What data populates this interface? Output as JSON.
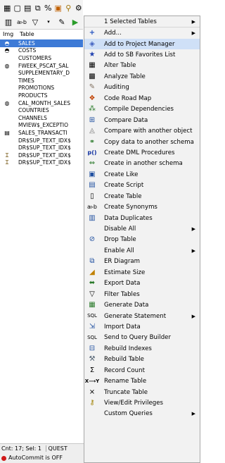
{
  "toolbar": {
    "row1_icons": [
      "table-icon",
      "new-icon",
      "open-icon",
      "copy-icon",
      "percent-icon",
      "run-icon",
      "search-icon",
      "tools-icon"
    ],
    "row2_icons": [
      "grid-icon",
      "ab-icon",
      "filter-icon",
      "dropdown-icon",
      "wrench-icon",
      "play-icon"
    ]
  },
  "grid": {
    "col_img": "Img",
    "col_table": "Table",
    "rows": [
      {
        "name": "SALES",
        "icon": "table-icon",
        "selected": true
      },
      {
        "name": "COSTS",
        "icon": "table-icon",
        "selected": false
      },
      {
        "name": "CUSTOMERS",
        "icon": "",
        "selected": false
      },
      {
        "name": "FWEEK_PSCAT_SAL",
        "icon": "partition-icon",
        "selected": false
      },
      {
        "name": "SUPPLEMENTARY_D",
        "icon": "",
        "selected": false
      },
      {
        "name": "TIMES",
        "icon": "",
        "selected": false
      },
      {
        "name": "PROMOTIONS",
        "icon": "",
        "selected": false
      },
      {
        "name": "PRODUCTS",
        "icon": "",
        "selected": false
      },
      {
        "name": "CAL_MONTH_SALES",
        "icon": "partition-icon",
        "selected": false
      },
      {
        "name": "COUNTRIES",
        "icon": "",
        "selected": false
      },
      {
        "name": "CHANNELS",
        "icon": "",
        "selected": false
      },
      {
        "name": "MVIEW$_EXCEPTIO",
        "icon": "",
        "selected": false
      },
      {
        "name": "SALES_TRANSACTI",
        "icon": "doc-icon",
        "selected": false
      },
      {
        "name": "DR$SUP_TEXT_IDX$",
        "icon": "",
        "selected": false
      },
      {
        "name": "DR$SUP_TEXT_IDX$",
        "icon": "",
        "selected": false
      },
      {
        "name": "DR$SUP_TEXT_IDX$",
        "icon": "bar-icon",
        "selected": false
      },
      {
        "name": "DR$SUP_TEXT_IDX$",
        "icon": "bar-icon",
        "selected": false
      }
    ]
  },
  "status": {
    "counts": "Cnt: 17; Sel: 1",
    "mode": "QUEST",
    "autocommit": "AutoCommit is OFF"
  },
  "menu": {
    "items": [
      {
        "label": "1 Selected Tables",
        "icon": "",
        "submenu": true,
        "highlight": false
      },
      {
        "label": "Add...",
        "icon": "plus-icon",
        "submenu": true,
        "highlight": false
      },
      {
        "label": "Add to Project Manager",
        "icon": "project-icon",
        "submenu": false,
        "highlight": true
      },
      {
        "label": "Add to SB Favorites List",
        "icon": "star-icon",
        "submenu": false,
        "highlight": false
      },
      {
        "label": "Alter Table",
        "icon": "alter-icon",
        "submenu": false,
        "highlight": false
      },
      {
        "label": "Analyze Table",
        "icon": "analyze-icon",
        "submenu": false,
        "highlight": false
      },
      {
        "label": "Auditing",
        "icon": "audit-icon",
        "submenu": false,
        "highlight": false
      },
      {
        "label": "Code Road Map",
        "icon": "roadmap-icon",
        "submenu": false,
        "highlight": false
      },
      {
        "label": "Compile Dependencies",
        "icon": "compile-icon",
        "submenu": false,
        "highlight": false
      },
      {
        "label": "Compare Data",
        "icon": "compare-data-icon",
        "submenu": false,
        "highlight": false
      },
      {
        "label": "Compare with another object",
        "icon": "compare-icon",
        "submenu": false,
        "highlight": false
      },
      {
        "label": "Copy data to another schema",
        "icon": "copy-data-icon",
        "submenu": false,
        "highlight": false
      },
      {
        "label": "Create DML Procedures",
        "icon": "dml-icon",
        "submenu": false,
        "highlight": false
      },
      {
        "label": "Create in another schema",
        "icon": "schema-icon",
        "submenu": false,
        "highlight": false
      },
      {
        "label": "Create Like",
        "icon": "create-like-icon",
        "submenu": false,
        "highlight": false
      },
      {
        "label": "Create Script",
        "icon": "script-icon",
        "submenu": false,
        "highlight": false
      },
      {
        "label": "Create Table",
        "icon": "create-table-icon",
        "submenu": false,
        "highlight": false
      },
      {
        "label": "Create Synonyms",
        "icon": "synonym-icon",
        "submenu": false,
        "highlight": false
      },
      {
        "label": "Data Duplicates",
        "icon": "duplicates-icon",
        "submenu": false,
        "highlight": false
      },
      {
        "label": "Disable All",
        "icon": "",
        "submenu": true,
        "highlight": false
      },
      {
        "label": "Drop Table",
        "icon": "drop-icon",
        "submenu": false,
        "highlight": false
      },
      {
        "label": "Enable All",
        "icon": "",
        "submenu": true,
        "highlight": false
      },
      {
        "label": "ER Diagram",
        "icon": "er-icon",
        "submenu": false,
        "highlight": false
      },
      {
        "label": "Estimate Size",
        "icon": "estimate-icon",
        "submenu": false,
        "highlight": false
      },
      {
        "label": "Export Data",
        "icon": "export-icon",
        "submenu": false,
        "highlight": false
      },
      {
        "label": "Filter Tables",
        "icon": "filter-icon",
        "submenu": false,
        "highlight": false
      },
      {
        "label": "Generate Data",
        "icon": "generate-icon",
        "submenu": false,
        "highlight": false
      },
      {
        "label": "Generate Statement",
        "icon": "statement-icon",
        "submenu": true,
        "highlight": false
      },
      {
        "label": "Import Data",
        "icon": "import-icon",
        "submenu": false,
        "highlight": false
      },
      {
        "label": "Send to Query Builder",
        "icon": "sql-icon",
        "submenu": false,
        "highlight": false
      },
      {
        "label": "Rebuild Indexes",
        "icon": "rebuild-idx-icon",
        "submenu": false,
        "highlight": false
      },
      {
        "label": "Rebuild Table",
        "icon": "rebuild-table-icon",
        "submenu": false,
        "highlight": false
      },
      {
        "label": "Record Count",
        "icon": "sigma-icon",
        "submenu": false,
        "highlight": false
      },
      {
        "label": "Rename Table",
        "icon": "rename-icon",
        "submenu": false,
        "highlight": false
      },
      {
        "label": "Truncate Table",
        "icon": "truncate-icon",
        "submenu": false,
        "highlight": false
      },
      {
        "label": "View/Edit Privileges",
        "icon": "privileges-icon",
        "submenu": false,
        "highlight": false
      },
      {
        "label": "Custom Queries",
        "icon": "",
        "submenu": true,
        "highlight": false
      }
    ]
  },
  "colors": {
    "selection": "#3d7ad6",
    "menu_highlight": "#cfe0f7",
    "menu_bg": "#f2f2f2",
    "status_red": "#d01818"
  }
}
